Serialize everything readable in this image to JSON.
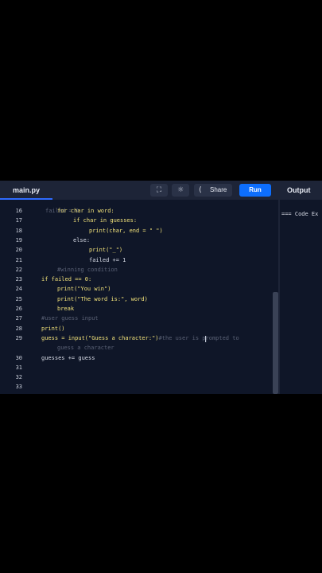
{
  "tab": {
    "label": "main.py"
  },
  "toolbar": {
    "share_label": "Share",
    "run_label": "Run",
    "output_label": "Output"
  },
  "icons": {
    "fullscreen": "fullscreen-icon",
    "theme": "sun-icon",
    "share": "share-icon"
  },
  "editor": {
    "partial_top": "failed = 0",
    "lines": [
      {
        "no": "16",
        "indent": 1,
        "text": "for char in word:"
      },
      {
        "no": "17",
        "indent": 2,
        "text": "if char in guesses:"
      },
      {
        "no": "18",
        "indent": 3,
        "text": "print(char, end = \" \")"
      },
      {
        "no": "19",
        "indent": 2,
        "text": "else:"
      },
      {
        "no": "20",
        "indent": 3,
        "text": "print(\"_\")"
      },
      {
        "no": "21",
        "indent": 3,
        "text": "failed += 1"
      },
      {
        "no": "22",
        "indent": 1,
        "text": "#winning condition"
      },
      {
        "no": "23",
        "indent": 0,
        "text": "if failed == 0:"
      },
      {
        "no": "24",
        "indent": 1,
        "text": "print(\"You win\")"
      },
      {
        "no": "25",
        "indent": 1,
        "text": "print(\"The word is:\", word)"
      },
      {
        "no": "26",
        "indent": 1,
        "text": "break"
      },
      {
        "no": "27",
        "indent": 0,
        "text": "#user guess input"
      },
      {
        "no": "28",
        "indent": 0,
        "text": "print()"
      },
      {
        "no": "29",
        "indent": 0,
        "text": "guess = input(\"Guess a character:\")#the user is prompted to"
      },
      {
        "no": "",
        "indent": 1,
        "text": "guess a character"
      },
      {
        "no": "30",
        "indent": 0,
        "text": "guesses += guess"
      },
      {
        "no": "31",
        "indent": 0,
        "text": ""
      },
      {
        "no": "32",
        "indent": 0,
        "text": ""
      },
      {
        "no": "33",
        "indent": 0,
        "text": ""
      }
    ]
  },
  "output": {
    "text": "=== Code Ex"
  },
  "colors": {
    "accent": "#0d6efd",
    "background": "#0f1628",
    "toolbar": "#1d2437"
  }
}
